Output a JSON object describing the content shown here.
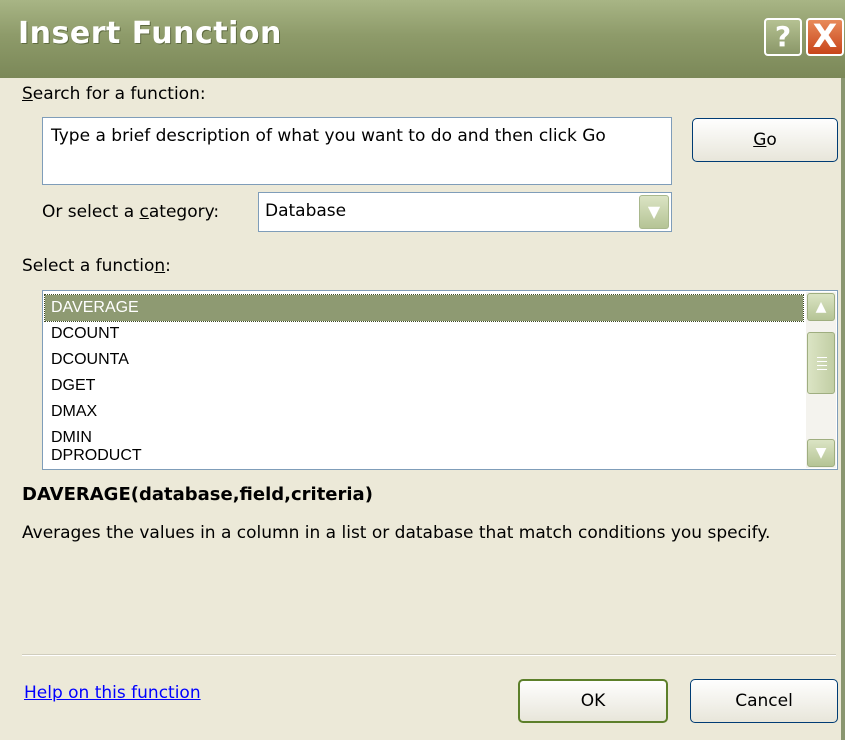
{
  "window": {
    "title": "Insert Function",
    "help_icon": "?",
    "close_icon": "X"
  },
  "search": {
    "label_prefix": "",
    "label_accel": "S",
    "label_rest": "earch for a function:",
    "value": "Type a brief description of what you want to do and then click Go",
    "go_accel": "G",
    "go_rest": "o"
  },
  "category": {
    "label_pre": "Or select a ",
    "label_accel": "c",
    "label_rest": "ategory:",
    "selected": "Database"
  },
  "functions": {
    "label_pre": "Select a functio",
    "label_accel": "n",
    "label_rest": ":",
    "items": [
      "DAVERAGE",
      "DCOUNT",
      "DCOUNTA",
      "DGET",
      "DMAX",
      "DMIN",
      "DPRODUCT"
    ],
    "selected_index": 0
  },
  "details": {
    "syntax": "DAVERAGE(database,field,criteria)",
    "description": "Averages the values in a column in a list or database that match conditions you specify."
  },
  "footer": {
    "help_link": "Help on this function",
    "ok": "OK",
    "cancel": "Cancel"
  },
  "colors": {
    "title_bar": "#8e9b6a",
    "selection": "#8e9a72",
    "close": "#c8451a",
    "link": "#0000ff"
  }
}
